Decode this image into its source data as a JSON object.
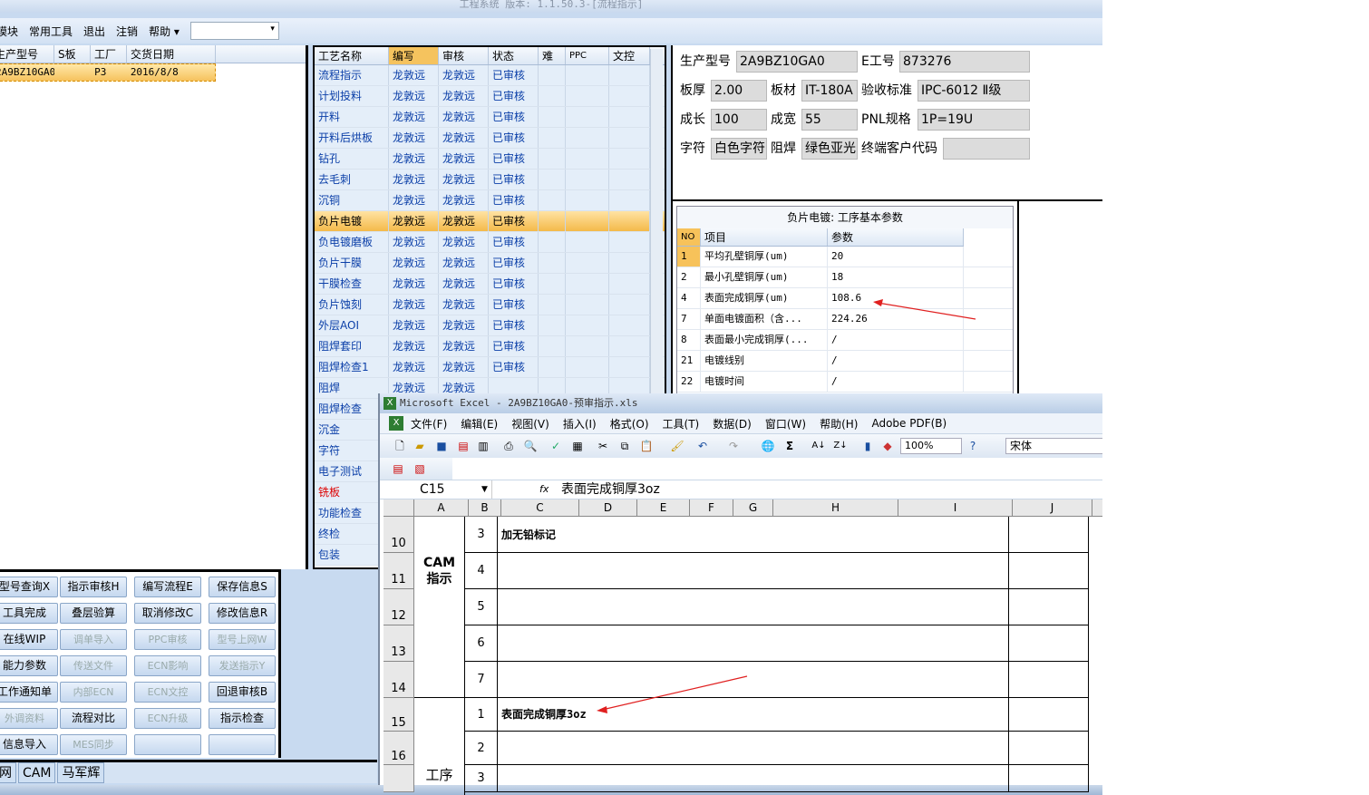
{
  "app": {
    "title": "工程系统 版本: 1.1.50.3-[流程指示]"
  },
  "menu": {
    "items": [
      "模块",
      "常用工具",
      "退出",
      "注销",
      "帮助 ▾"
    ],
    "combo_value": ""
  },
  "orders": {
    "headers": [
      "生产型号",
      "S板",
      "工厂",
      "交货日期"
    ],
    "rows": [
      {
        "model": "2A9BZ10GA0",
        "s": "",
        "factory": "P3",
        "date": "2016/8/8"
      }
    ]
  },
  "process": {
    "headers": [
      "工艺名称",
      "编写",
      "审核",
      "状态",
      "难",
      "PPC",
      "文控"
    ],
    "rows": [
      {
        "name": "流程指示",
        "writer": "龙敦远",
        "reviewer": "龙敦远",
        "status": "已审核"
      },
      {
        "name": "计划投料",
        "writer": "龙敦远",
        "reviewer": "龙敦远",
        "status": "已审核"
      },
      {
        "name": "开料",
        "writer": "龙敦远",
        "reviewer": "龙敦远",
        "status": "已审核"
      },
      {
        "name": "开料后烘板",
        "writer": "龙敦远",
        "reviewer": "龙敦远",
        "status": "已审核"
      },
      {
        "name": "钻孔",
        "writer": "龙敦远",
        "reviewer": "龙敦远",
        "status": "已审核"
      },
      {
        "name": "去毛刺",
        "writer": "龙敦远",
        "reviewer": "龙敦远",
        "status": "已审核"
      },
      {
        "name": "沉铜",
        "writer": "龙敦远",
        "reviewer": "龙敦远",
        "status": "已审核"
      },
      {
        "name": "负片电镀",
        "writer": "龙敦远",
        "reviewer": "龙敦远",
        "status": "已审核"
      },
      {
        "name": "负电镀磨板",
        "writer": "龙敦远",
        "reviewer": "龙敦远",
        "status": "已审核"
      },
      {
        "name": "负片干膜",
        "writer": "龙敦远",
        "reviewer": "龙敦远",
        "status": "已审核"
      },
      {
        "name": "干膜检查",
        "writer": "龙敦远",
        "reviewer": "龙敦远",
        "status": "已审核"
      },
      {
        "name": "负片蚀刻",
        "writer": "龙敦远",
        "reviewer": "龙敦远",
        "status": "已审核"
      },
      {
        "name": "外层AOI",
        "writer": "龙敦远",
        "reviewer": "龙敦远",
        "status": "已审核"
      },
      {
        "name": "阻焊套印",
        "writer": "龙敦远",
        "reviewer": "龙敦远",
        "status": "已审核"
      },
      {
        "name": "阻焊检查1",
        "writer": "龙敦远",
        "reviewer": "龙敦远",
        "status": "已审核"
      },
      {
        "name": "阻焊",
        "writer": "龙敦远",
        "reviewer": "龙敦远",
        "status": ""
      },
      {
        "name": "阻焊检查",
        "writer": "",
        "reviewer": "",
        "status": ""
      },
      {
        "name": "沉金",
        "writer": "",
        "reviewer": "",
        "status": ""
      },
      {
        "name": "字符",
        "writer": "",
        "reviewer": "",
        "status": ""
      },
      {
        "name": "电子测试",
        "writer": "",
        "reviewer": "",
        "status": ""
      },
      {
        "name": "铣板",
        "writer": "",
        "reviewer": "",
        "status": ""
      },
      {
        "name": "功能检查",
        "writer": "",
        "reviewer": "",
        "status": ""
      },
      {
        "name": "终检",
        "writer": "",
        "reviewer": "",
        "status": ""
      },
      {
        "name": "包装",
        "writer": "",
        "reviewer": "",
        "status": ""
      }
    ]
  },
  "info": {
    "model_label": "生产型号",
    "model": "2A9BZ10GA0",
    "eno_label": "E工号",
    "eno": "873276",
    "thick_label": "板厚",
    "thick": "2.00",
    "material_label": "板材",
    "material": "IT-180A",
    "std_label": "验收标准",
    "std": "IPC-6012 Ⅱ级",
    "len_label": "成长",
    "len": "100",
    "width_label": "成宽",
    "width": "55",
    "pnl_label": "PNL规格",
    "pnl": "1P=19U",
    "char_label": "字符",
    "char": "白色字符",
    "mask_label": "阻焊",
    "mask": "绿色亚光",
    "cust_label": "终端客户代码",
    "cust": ""
  },
  "params": {
    "title": "负片电镀: 工序基本参数",
    "headers": [
      "NO",
      "项目",
      "参数"
    ],
    "rows": [
      {
        "no": "1",
        "item": "平均孔壁铜厚(um)",
        "value": "20"
      },
      {
        "no": "2",
        "item": "最小孔壁铜厚(um)",
        "value": "18"
      },
      {
        "no": "4",
        "item": "表面完成铜厚(um)",
        "value": "108.6"
      },
      {
        "no": "7",
        "item": "单面电镀面积（含...",
        "value": "224.26"
      },
      {
        "no": "8",
        "item": "表面最小完成铜厚(...",
        "value": "/"
      },
      {
        "no": "21",
        "item": "电镀线别",
        "value": "/"
      },
      {
        "no": "22",
        "item": "电镀时间",
        "value": "/"
      }
    ]
  },
  "buttons": [
    [
      "型号查询X",
      "指示审核H",
      "编写流程E",
      "保存信息S"
    ],
    [
      "工具完成",
      "叠层验算",
      "取消修改C",
      "修改信息R"
    ],
    [
      "在线WIP",
      "调单导入",
      "PPC审核",
      "型号上网W"
    ],
    [
      "能力参数",
      "传送文件",
      "ECN影响",
      "发送指示Y"
    ],
    [
      "工作通知单",
      "内部ECN",
      "ECN文控",
      "回退审核B"
    ],
    [
      "外调资料",
      "流程对比",
      "ECN升级",
      "指示检查"
    ],
    [
      "信息导入",
      "MES同步",
      "",
      ""
    ]
  ],
  "buttons_disabled": [
    [
      false,
      false,
      false,
      false
    ],
    [
      false,
      false,
      false,
      false
    ],
    [
      false,
      true,
      true,
      true
    ],
    [
      false,
      true,
      true,
      true
    ],
    [
      false,
      true,
      true,
      false
    ],
    [
      true,
      false,
      true,
      false
    ],
    [
      false,
      true,
      false,
      false
    ]
  ],
  "tabs": [
    "网",
    "CAM",
    "马军辉"
  ],
  "excel": {
    "title": "Microsoft Excel - 2A9BZ10GA0-预审指示.xls",
    "menu": [
      "文件(F)",
      "编辑(E)",
      "视图(V)",
      "插入(I)",
      "格式(O)",
      "工具(T)",
      "数据(D)",
      "窗口(W)",
      "帮助(H)",
      "Adobe PDF(B)"
    ],
    "zoom": "100%",
    "font": "宋体",
    "name_box": "C15",
    "fx": "fx",
    "formula": "表面完成铜厚3oz",
    "columns": [
      "A",
      "B",
      "C",
      "D",
      "E",
      "F",
      "G",
      "H",
      "I",
      "J"
    ],
    "rows": [
      {
        "num": "10",
        "b": "3",
        "c": "加无铅标记"
      },
      {
        "num": "11",
        "b": "4",
        "c": ""
      },
      {
        "num": "12",
        "b": "5",
        "c": ""
      },
      {
        "num": "13",
        "b": "6",
        "c": ""
      },
      {
        "num": "14",
        "b": "7",
        "c": ""
      },
      {
        "num": "15",
        "b": "1",
        "c": "表面完成铜厚3oz"
      },
      {
        "num": "16",
        "b": "2",
        "c": ""
      },
      {
        "num": "",
        "b": "3",
        "c": ""
      }
    ],
    "group1": "CAM\n指示",
    "group2": "工序"
  },
  "colors": {
    "accent": "#f4b94a",
    "annotation": "#e02020",
    "link": "#0b3fa8"
  }
}
